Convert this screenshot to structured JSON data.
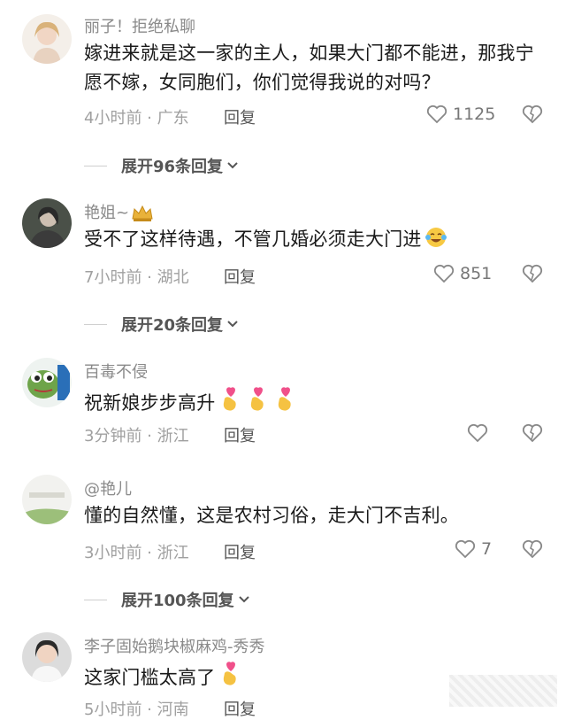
{
  "comments": [
    {
      "username": "丽子！拒绝私聊",
      "text": "嫁进来就是这一家的主人，如果大门都不能进，那我宁愿不嫁，女同胞们，你们觉得我说的对吗？",
      "meta": "4小时前 · 广东",
      "reply": "回复",
      "likes": "1125"
    },
    {
      "username": "艳姐~",
      "text": "受不了这样待遇，不管几婚必须走大门进",
      "meta": "7小时前 · 湖北",
      "reply": "回复",
      "likes": "851"
    },
    {
      "username": "百毒不侵",
      "text": "祝新娘步步高升",
      "meta": "3分钟前 · 浙江",
      "reply": "回复",
      "likes": ""
    },
    {
      "username": "@艳儿",
      "text": "懂的自然懂，这是农村习俗，走大门不吉利。",
      "meta": "3小时前 · 浙江",
      "reply": "回复",
      "likes": "7"
    },
    {
      "username": "李子固始鹅块椒麻鸡-秀秀",
      "text": "这家门槛太高了",
      "meta": "5小时前 · 河南",
      "reply": "回复",
      "likes": ""
    }
  ],
  "expand_replies": [
    "展开96条回复",
    "展开20条回复",
    "展开100条回复"
  ],
  "icons": {
    "like": "heart-outline-icon",
    "dislike": "broken-heart-icon",
    "expand": "chevron-down-icon",
    "crown": "crown-icon",
    "heart_hands": "heart-fingers-icon",
    "laugh": "laughing-tears-icon"
  },
  "colors": {
    "text": "#1a1a1a",
    "username": "#8a8a8a",
    "meta": "#a0a0a0",
    "heart_emoji": "#f0508a",
    "hand_emoji": "#f5c242"
  }
}
